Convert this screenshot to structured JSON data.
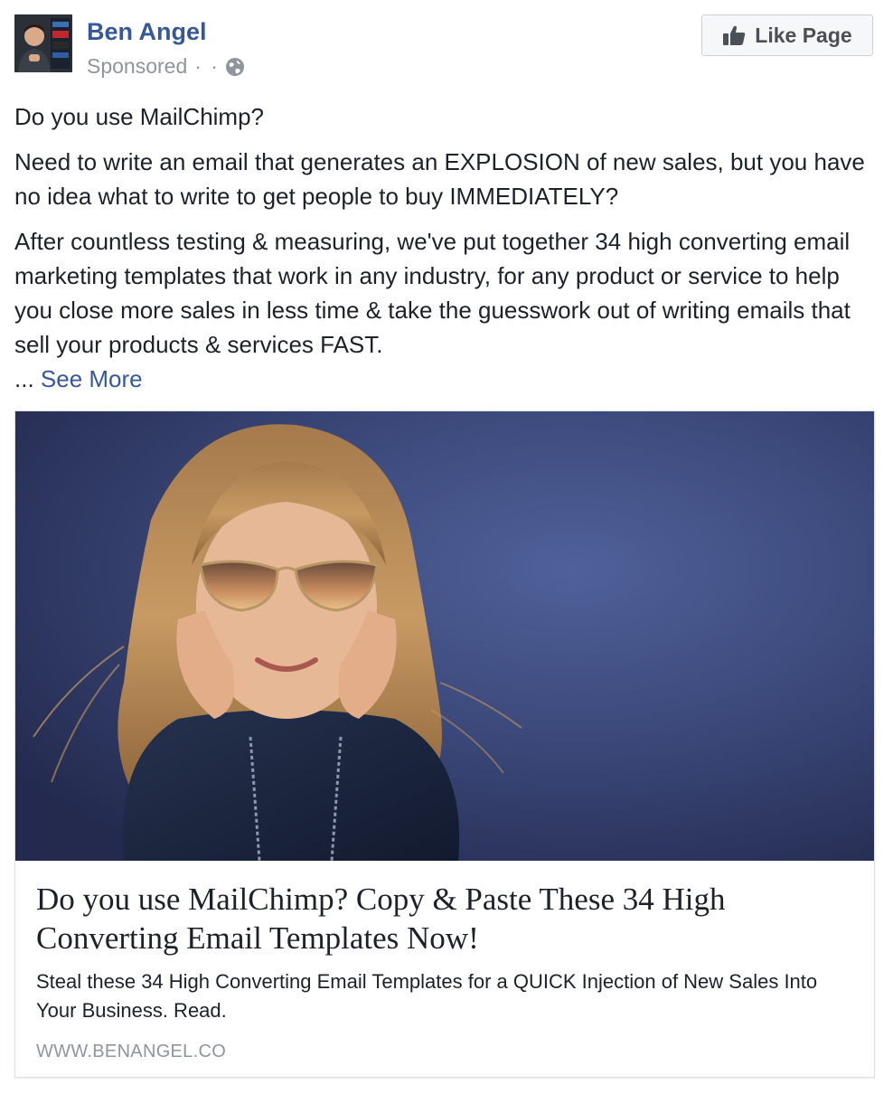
{
  "post": {
    "author": "Ben Angel",
    "sponsored_label": "Sponsored",
    "meta_dots": "· ·",
    "like_button_label": "Like Page",
    "icons": {
      "thumb": "thumbs-up-icon",
      "globe": "globe-icon"
    },
    "colors": {
      "link_blue": "#365899",
      "meta_gray": "#90949c",
      "text": "#1d2129"
    }
  },
  "body": {
    "line1": "Do you use MailChimp?",
    "line2": "Need to write an email that generates an EXPLOSION of new sales, but you have no idea what to write to get people to buy IMMEDIATELY?",
    "line3": "After countless testing & measuring, we've put together 34 high converting email marketing templates that work in any industry, for any product or service to help you close more sales in less time & take the guesswork out of writing emails that sell your products & services FAST.",
    "ellipsis": "...",
    "see_more": "See More"
  },
  "card": {
    "title": "Do you use MailChimp? Copy & Paste These 34 High Converting Email Templates Now!",
    "description": "Steal these 34 High Converting Email Templates for a QUICK Injection of New Sales Into Your Business. Read.",
    "domain": "WWW.BENANGEL.CO"
  }
}
